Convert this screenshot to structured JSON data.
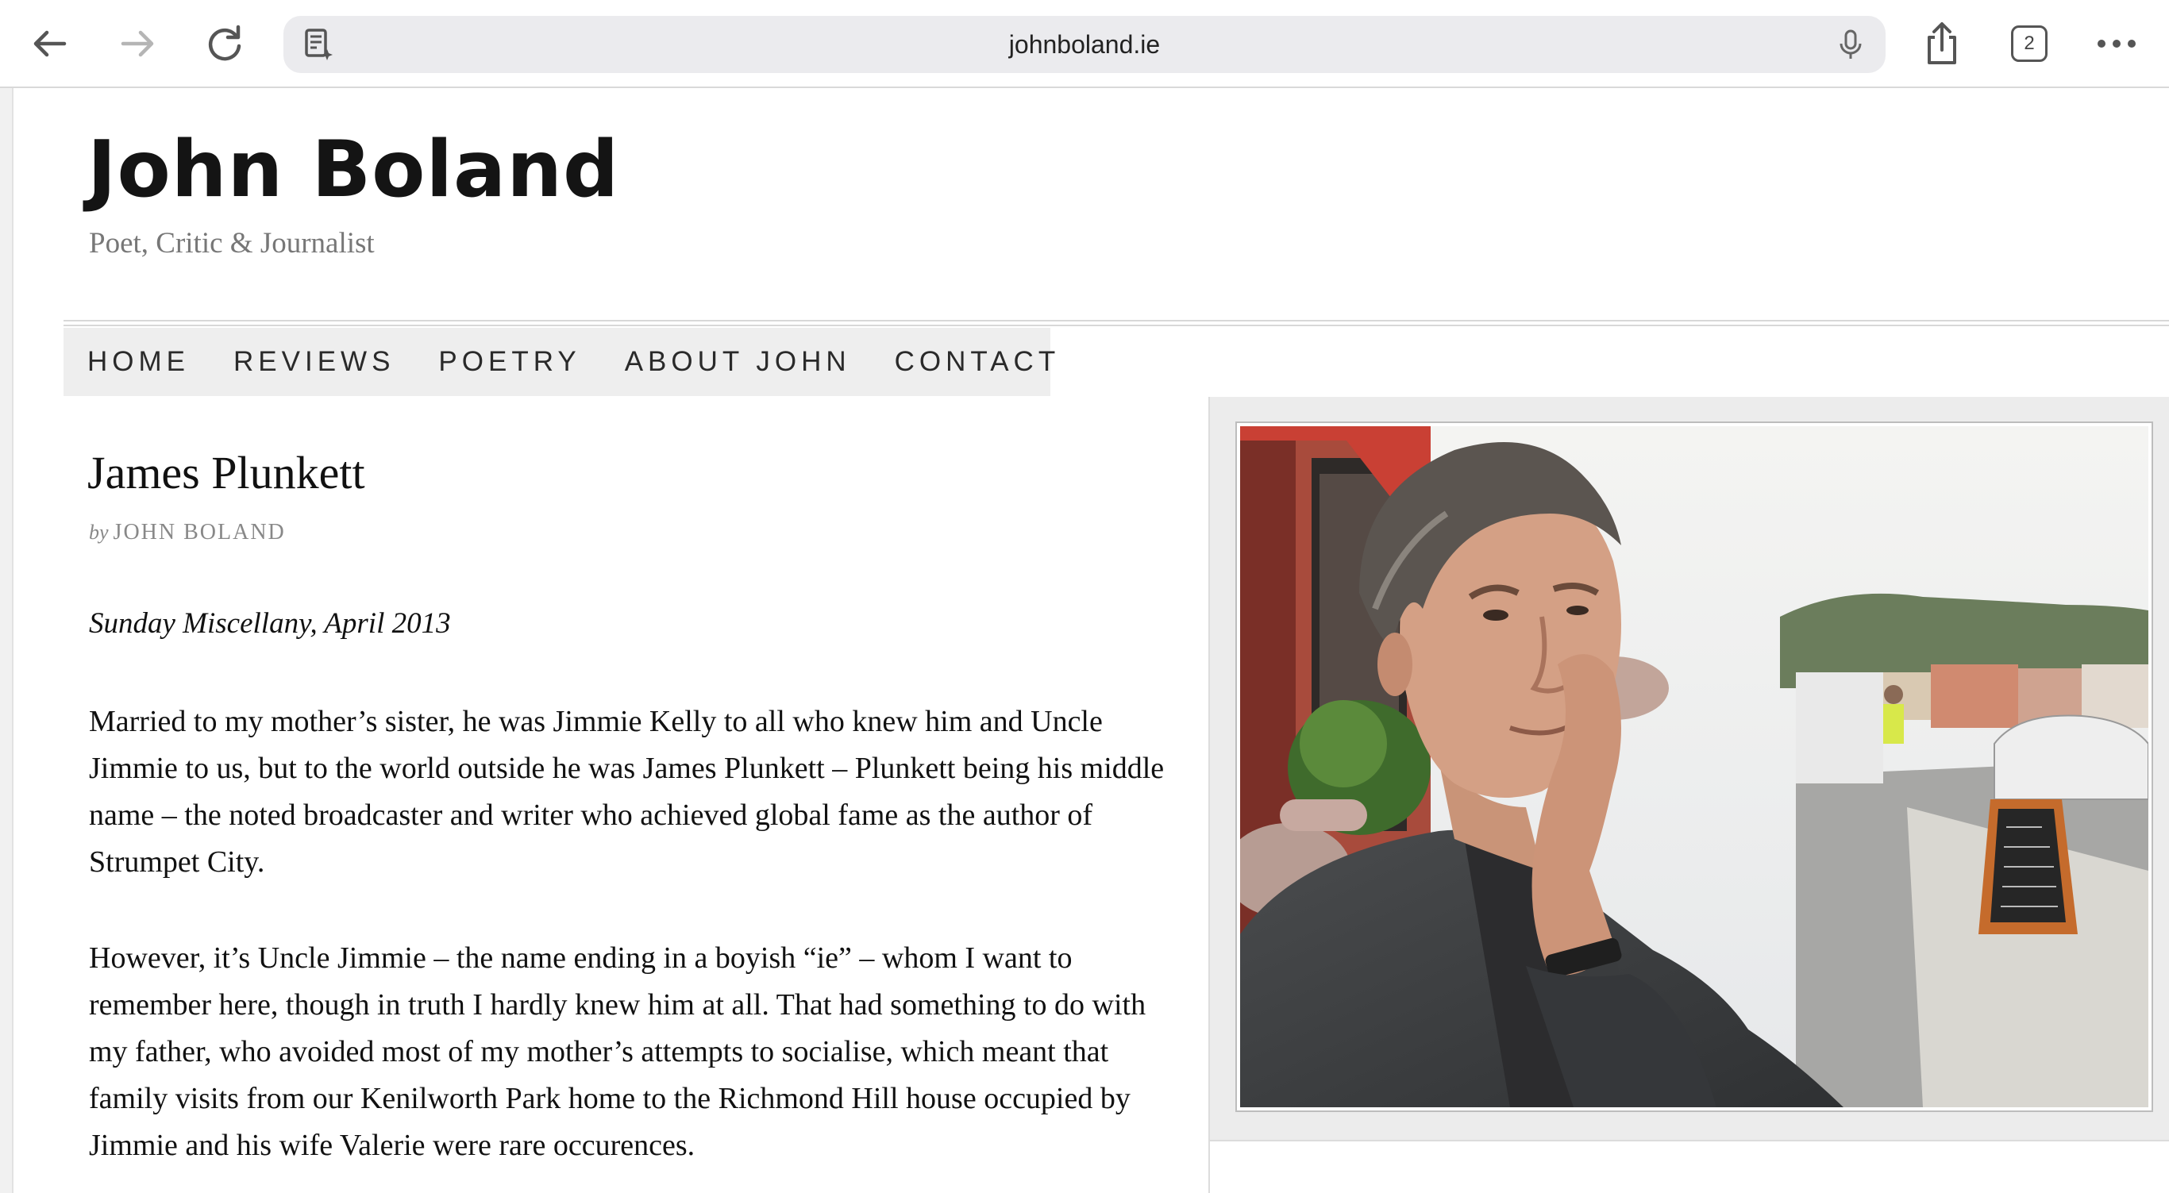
{
  "browser": {
    "url": "johnboland.ie",
    "tab_count": "2"
  },
  "site": {
    "title": "John Boland",
    "tagline": "Poet, Critic & Journalist"
  },
  "nav": {
    "items": [
      "HOME",
      "REVIEWS",
      "POETRY",
      "ABOUT JOHN",
      "CONTACT"
    ]
  },
  "article": {
    "title": "James Plunkett",
    "byline_prefix": "by",
    "byline_author": "JOHN BOLAND",
    "source": "Sunday Miscellany, April 2013",
    "paragraphs": [
      "Married to my mother’s sister, he was Jimmie Kelly to all who knew him and Uncle Jimmie to us, but to the world outside he was James Plunkett – Plunkett being his middle name – the noted broadcaster and writer who achieved global fame as the author of Strumpet City.",
      "However, it’s Uncle Jimmie – the name ending in a boyish “ie” – whom I want to remember here, though in truth I hardly knew him at all. That had something to do with my father, who avoided most of my mother’s attempts to socialise, which meant that family visits from our Kenilworth Park home to the Richmond Hill house occupied by Jimmie and his wife Valerie were rare occurences."
    ]
  },
  "sidebar": {
    "image_name": "portrait-photo"
  }
}
